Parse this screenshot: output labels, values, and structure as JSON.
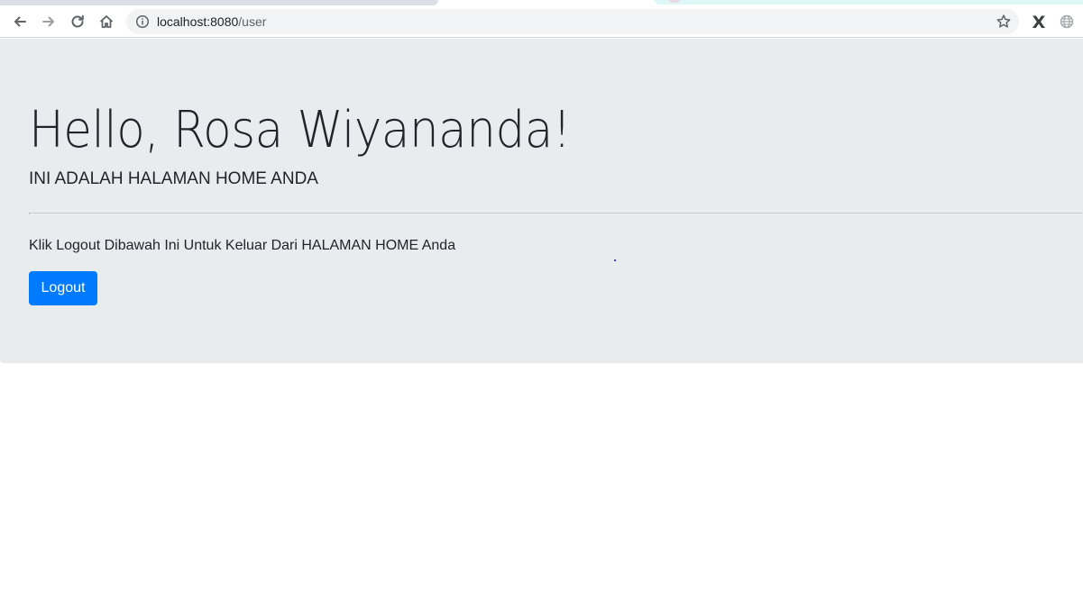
{
  "browser": {
    "address_bar": {
      "host": "localhost:8080",
      "path": "/user"
    },
    "icons": {
      "back": "arrow-left-icon",
      "forward": "arrow-right-icon",
      "reload": "reload-icon",
      "home": "home-icon",
      "site_info": "info-icon",
      "bookmark": "star-icon",
      "extension_1": "x-extension-icon",
      "extension_2": "globe-icon"
    },
    "extension_label": "X"
  },
  "page": {
    "title": "Hello, Rosa Wiyananda!",
    "lead": "INI ADALAH HALAMAN HOME ANDA",
    "instruction": "Klik Logout Dibawah Ini Untuk Keluar Dari HALAMAN HOME Anda",
    "logout_label": "Logout"
  },
  "colors": {
    "jumbotron_bg": "#e9ecef",
    "primary": "#007bff",
    "text": "#212529"
  }
}
